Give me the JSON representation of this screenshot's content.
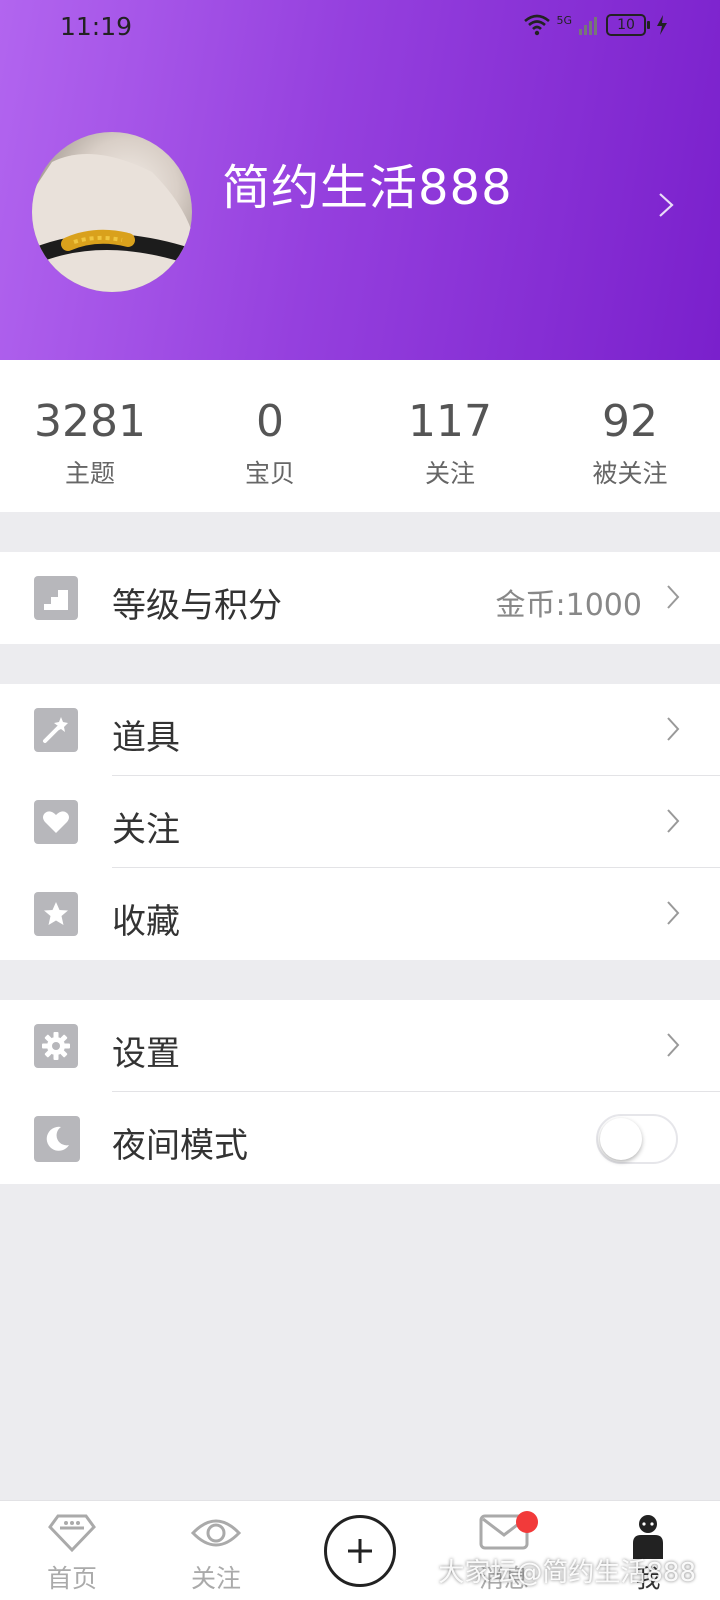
{
  "status_bar": {
    "time": "11:19",
    "network": "5G",
    "battery": "10"
  },
  "profile": {
    "username": "简约生活888"
  },
  "stats": [
    {
      "value": "3281",
      "label": "主题"
    },
    {
      "value": "0",
      "label": "宝贝"
    },
    {
      "value": "117",
      "label": "关注"
    },
    {
      "value": "92",
      "label": "被关注"
    }
  ],
  "menu": {
    "level": {
      "label": "等级与积分",
      "value": "金币:1000"
    },
    "props": {
      "label": "道具"
    },
    "following": {
      "label": "关注"
    },
    "favorites": {
      "label": "收藏"
    },
    "settings": {
      "label": "设置"
    },
    "night_mode": {
      "label": "夜间模式",
      "enabled": false
    }
  },
  "bottom_nav": [
    {
      "label": "首页",
      "icon": "diamond-icon"
    },
    {
      "label": "关注",
      "icon": "eye-icon"
    },
    {
      "label": "",
      "icon": "plus-icon"
    },
    {
      "label": "消息",
      "icon": "mail-icon"
    },
    {
      "label": "我",
      "icon": "person-icon"
    }
  ],
  "watermark": "大家坛@简约生活888"
}
